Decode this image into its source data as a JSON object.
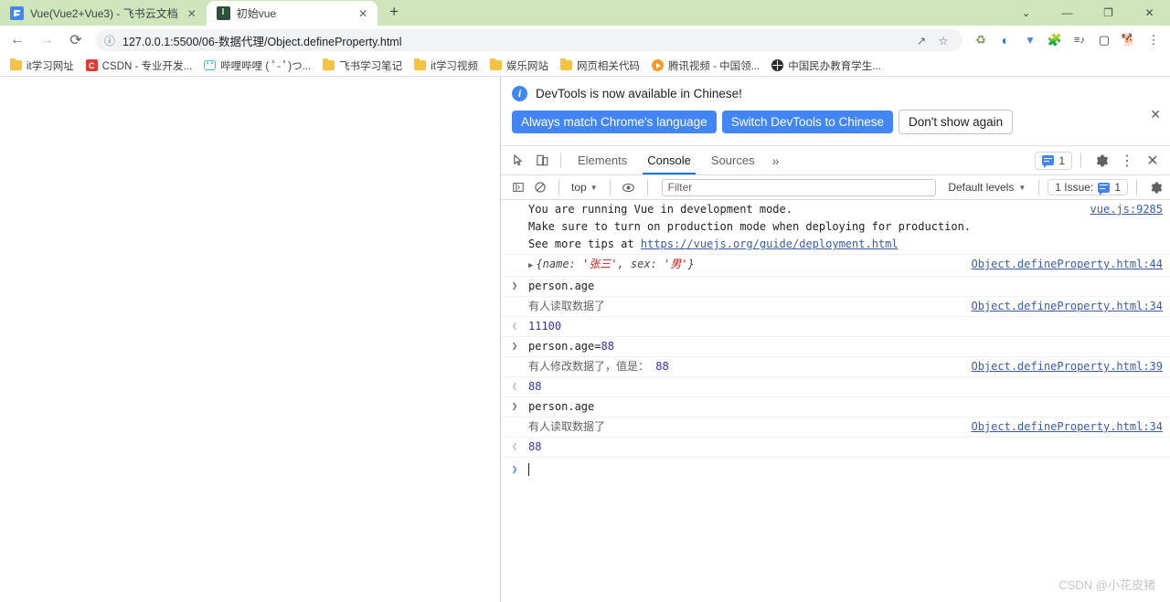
{
  "browser": {
    "tabs": [
      {
        "title": "Vue(Vue2+Vue3) - 飞书云文档",
        "favicon": "vue-doc-icon",
        "active": false,
        "close_label": "✕"
      },
      {
        "title": "初始vue",
        "favicon": "live-server-icon",
        "active": true,
        "close_label": "✕"
      }
    ],
    "new_tab_label": "+",
    "window_controls": {
      "expand": "⌄",
      "minimize": "—",
      "maximize": "❐",
      "close": "✕"
    },
    "nav": {
      "back": "←",
      "forward": "→",
      "reload": "⟳"
    },
    "omnibox": {
      "info_icon": "ⓘ",
      "url": "127.0.0.1:5500/06-数据代理/Object.defineProperty.html",
      "share_icon": "↗",
      "bookmark_icon": "☆"
    },
    "extensions": [
      {
        "name": "recycle-extension-icon",
        "glyph": "♻"
      },
      {
        "name": "opera-extension-icon",
        "glyph": "◐"
      },
      {
        "name": "v-extension-icon",
        "glyph": "▼"
      },
      {
        "name": "puzzle-extensions-icon",
        "glyph": "🧩"
      },
      {
        "name": "playlist-icon",
        "glyph": "≡♪"
      },
      {
        "name": "sidepanel-icon",
        "glyph": "▢"
      },
      {
        "name": "profile-avatar",
        "glyph": "🐕"
      },
      {
        "name": "chrome-menu-icon",
        "glyph": "⋮"
      }
    ],
    "bookmarks": [
      {
        "label": "it学习网址",
        "icon": "folder"
      },
      {
        "label": "CSDN - 专业开发...",
        "icon": "csdn"
      },
      {
        "label": "哔哩哔哩 ( ﾟ- ﾟ)つ...",
        "icon": "bilibili"
      },
      {
        "label": "飞书学习笔记",
        "icon": "folder"
      },
      {
        "label": "it学习视频",
        "icon": "folder"
      },
      {
        "label": "娱乐网站",
        "icon": "folder"
      },
      {
        "label": "网页相关代码",
        "icon": "folder"
      },
      {
        "label": "腾讯视频 - 中国领...",
        "icon": "tencent"
      },
      {
        "label": "中国民办教育学生...",
        "icon": "globe"
      }
    ]
  },
  "devtools": {
    "banner": {
      "message": "DevTools is now available in Chinese!",
      "buttons": [
        {
          "label": "Always match Chrome's language",
          "style": "primary"
        },
        {
          "label": "Switch DevTools to Chinese",
          "style": "primary"
        },
        {
          "label": "Don't show again",
          "style": "secondary"
        }
      ],
      "close_label": "✕"
    },
    "toolbar": {
      "inspect_icon": "cursor-select-icon",
      "device_icon": "device-toolbar-icon",
      "tabs": [
        {
          "label": "Elements",
          "selected": false
        },
        {
          "label": "Console",
          "selected": true
        },
        {
          "label": "Sources",
          "selected": false
        }
      ],
      "more_tabs_label": "»",
      "message_count": "1",
      "settings_icon": "gear-icon",
      "kebab_icon": "⋮",
      "close_label": "✕"
    },
    "filterbar": {
      "sidebar_icon": "console-sidebar-icon",
      "clear_icon": "clear-console-icon",
      "context": "top",
      "context_caret": "▼",
      "eye_icon": "live-expression-icon",
      "filter_placeholder": "Filter",
      "filter_value": "",
      "levels_label": "Default levels",
      "levels_caret": "▼",
      "issues_label": "1 Issue:",
      "issues_count": "1",
      "settings_icon": "gear-icon"
    },
    "console_rows": [
      {
        "kind": "warning",
        "gutter": "",
        "lines": [
          "You are running Vue in development mode.",
          "Make sure to turn on production mode when deploying for production.",
          "See more tips at "
        ],
        "link_text": "https://vuejs.org/guide/deployment.html",
        "source": "vue.js:9285"
      },
      {
        "kind": "object",
        "gutter": "",
        "triangle": "▶",
        "object_prefix": "{name: ",
        "object_str1": "'张三'",
        "object_mid": ", sex: ",
        "object_str2": "'男'",
        "object_suffix": "}",
        "source": "Object.defineProperty.html:44"
      },
      {
        "kind": "input",
        "gutter": "❯",
        "text": "person.age",
        "source": ""
      },
      {
        "kind": "log",
        "gutter": "",
        "text": "有人读取数据了",
        "source": "Object.defineProperty.html:34"
      },
      {
        "kind": "output",
        "gutter": "❮",
        "value": "11100",
        "source": ""
      },
      {
        "kind": "input-assign",
        "gutter": "❯",
        "text": "person.age=",
        "value": "88",
        "source": ""
      },
      {
        "kind": "log",
        "gutter": "",
        "text": "有人修改数据了，值是： ",
        "value": "88",
        "source": "Object.defineProperty.html:39"
      },
      {
        "kind": "output",
        "gutter": "❮",
        "value": "88",
        "source": ""
      },
      {
        "kind": "input",
        "gutter": "❯",
        "text": "person.age",
        "source": ""
      },
      {
        "kind": "log",
        "gutter": "",
        "text": "有人读取数据了",
        "source": "Object.defineProperty.html:34"
      },
      {
        "kind": "output",
        "gutter": "❮",
        "value": "88",
        "source": ""
      }
    ],
    "prompt": {
      "gutter": "❯",
      "value": ""
    }
  },
  "watermark": "CSDN @小花皮猪",
  "colors": {
    "accent_blue": "#4285f4",
    "tab_strip_green": "#cfe6bd",
    "warning_bg": "#fffbe5",
    "link": "#3b5ca8",
    "number": "#3232b4",
    "string_red": "#c41a16"
  }
}
